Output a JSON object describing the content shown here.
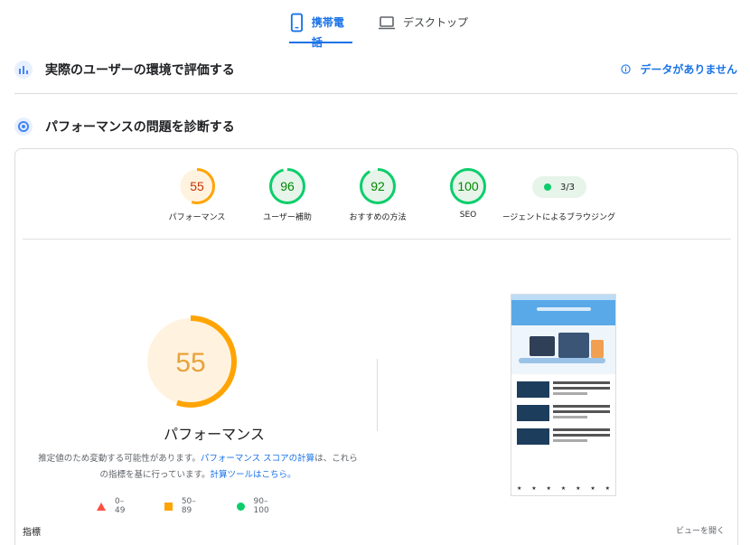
{
  "tabs": [
    {
      "label": "携帯電話",
      "active": true,
      "icon": "smartphone-icon"
    },
    {
      "label": "デスクトップ",
      "active": false,
      "icon": "laptop-icon"
    }
  ],
  "field_section": {
    "title": "実際のユーザーの環境で評価する",
    "no_data": "データがありません"
  },
  "diag_section": {
    "title": "パフォーマンスの問題を診断する"
  },
  "gauges": [
    {
      "label": "パフォーマンス",
      "score": "55",
      "value": 55,
      "color": "#ffa400",
      "bg": "#fff3e0",
      "text": "#c33300"
    },
    {
      "label": "ユーザー補助",
      "score": "96",
      "value": 96,
      "color": "#0cce6b",
      "bg": "#e6f4ea",
      "text": "#008800"
    },
    {
      "label": "おすすめの方法",
      "score": "92",
      "value": 92,
      "color": "#0cce6b",
      "bg": "#e6f4ea",
      "text": "#008800"
    },
    {
      "label": "SEO",
      "score": "100",
      "value": 100,
      "color": "#0cce6b",
      "bg": "#e6f4ea",
      "text": "#008800"
    }
  ],
  "agent": {
    "pill": "3/3",
    "label": "エージェントによるブラウジング"
  },
  "big": {
    "score": "55",
    "value": 55,
    "title": "パフォーマンス",
    "color": "#ffa400",
    "bg": "#fff3e0",
    "text": "#e8a33b"
  },
  "description": {
    "part1": "推定値のため変動する可能性があります。",
    "link1": "パフォーマンス スコアの計算",
    "part2": "は、これらの指標を基に行っています。",
    "link2": "計算ツールはこちら。"
  },
  "legend": {
    "fail": "0–49",
    "average": "50–89",
    "pass": "90–100"
  },
  "footer": {
    "metrics": "指標",
    "open_view": "ビューを開く"
  }
}
